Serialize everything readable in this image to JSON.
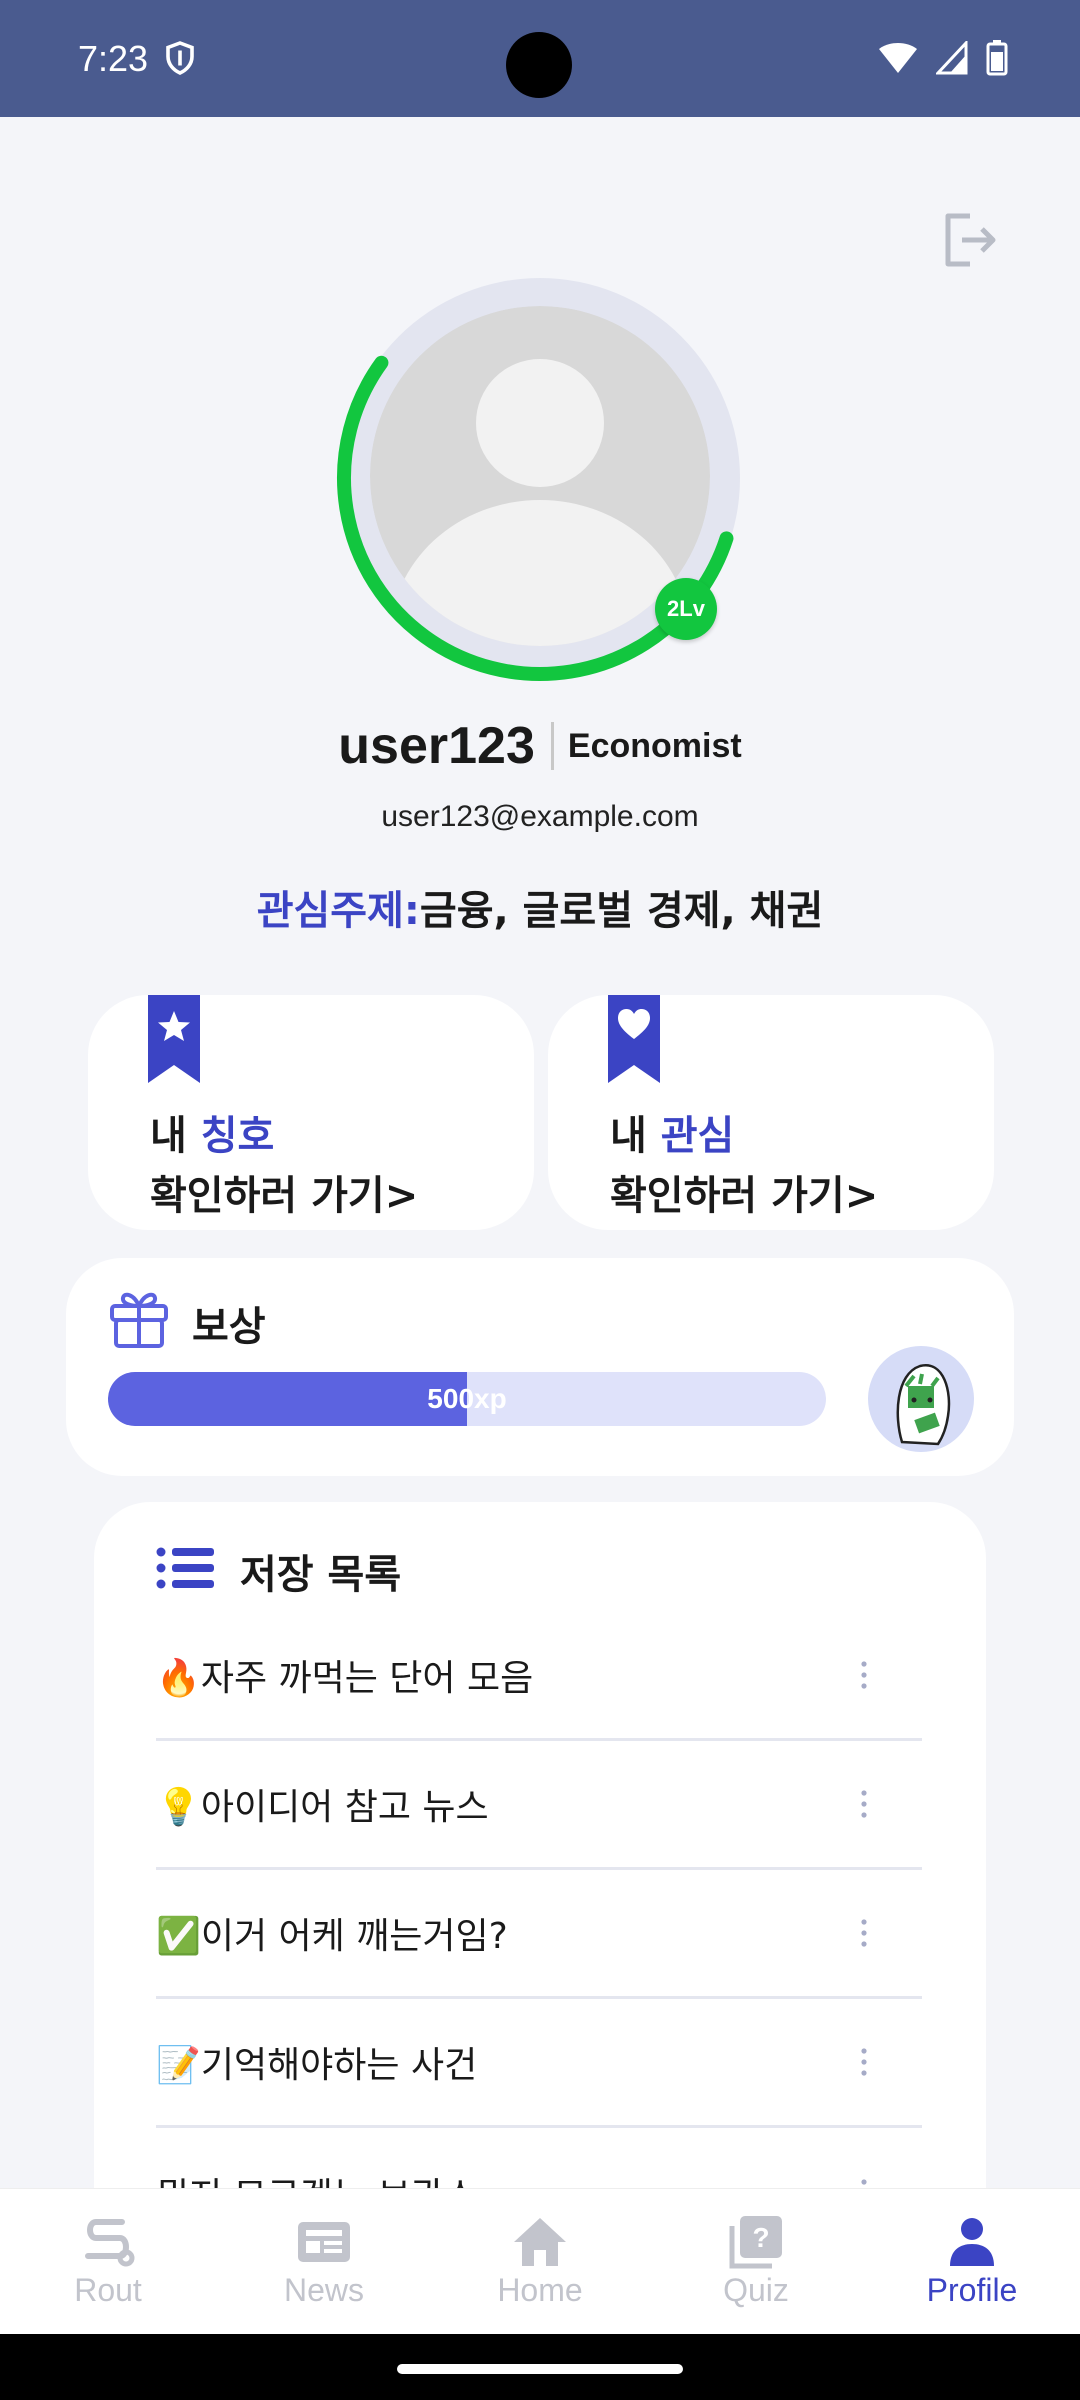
{
  "status_bar": {
    "time": "7:23"
  },
  "profile": {
    "username": "user123",
    "title": "Economist",
    "email": "user123@example.com",
    "level": "2Lv",
    "level_progress": 0.55,
    "interest_label": "관심주제:",
    "interest_value": "금융, 글로벌 경제, 채권"
  },
  "cards": {
    "title_card": {
      "prefix": "내 ",
      "accent": "칭호",
      "action": "확인하러 가기>"
    },
    "interest_card": {
      "prefix": "내 ",
      "accent": "관심",
      "action": "확인하러 가기>"
    }
  },
  "reward": {
    "title": "보상",
    "xp_label": "500xp",
    "xp_progress": 0.5
  },
  "saved": {
    "title": "저장 목록",
    "items": [
      {
        "label": "🔥자주 까먹는 단어 모음"
      },
      {
        "label": "💡아이디어 참고 뉴스"
      },
      {
        "label": "✅이거 어케 깨는거임?"
      },
      {
        "label": "📝기억해야하는 사건"
      },
      {
        "label": "뭔지 모르겠는 보관소"
      }
    ]
  },
  "nav": {
    "items": [
      {
        "label": "Rout"
      },
      {
        "label": "News"
      },
      {
        "label": "Home"
      },
      {
        "label": "Quiz"
      },
      {
        "label": "Profile"
      }
    ],
    "active": "Profile"
  },
  "colors": {
    "accent": "#3b44c4",
    "progress_green": "#12c63f",
    "status_bar": "#4a5b8f",
    "xp_fill": "#5c63e0"
  }
}
